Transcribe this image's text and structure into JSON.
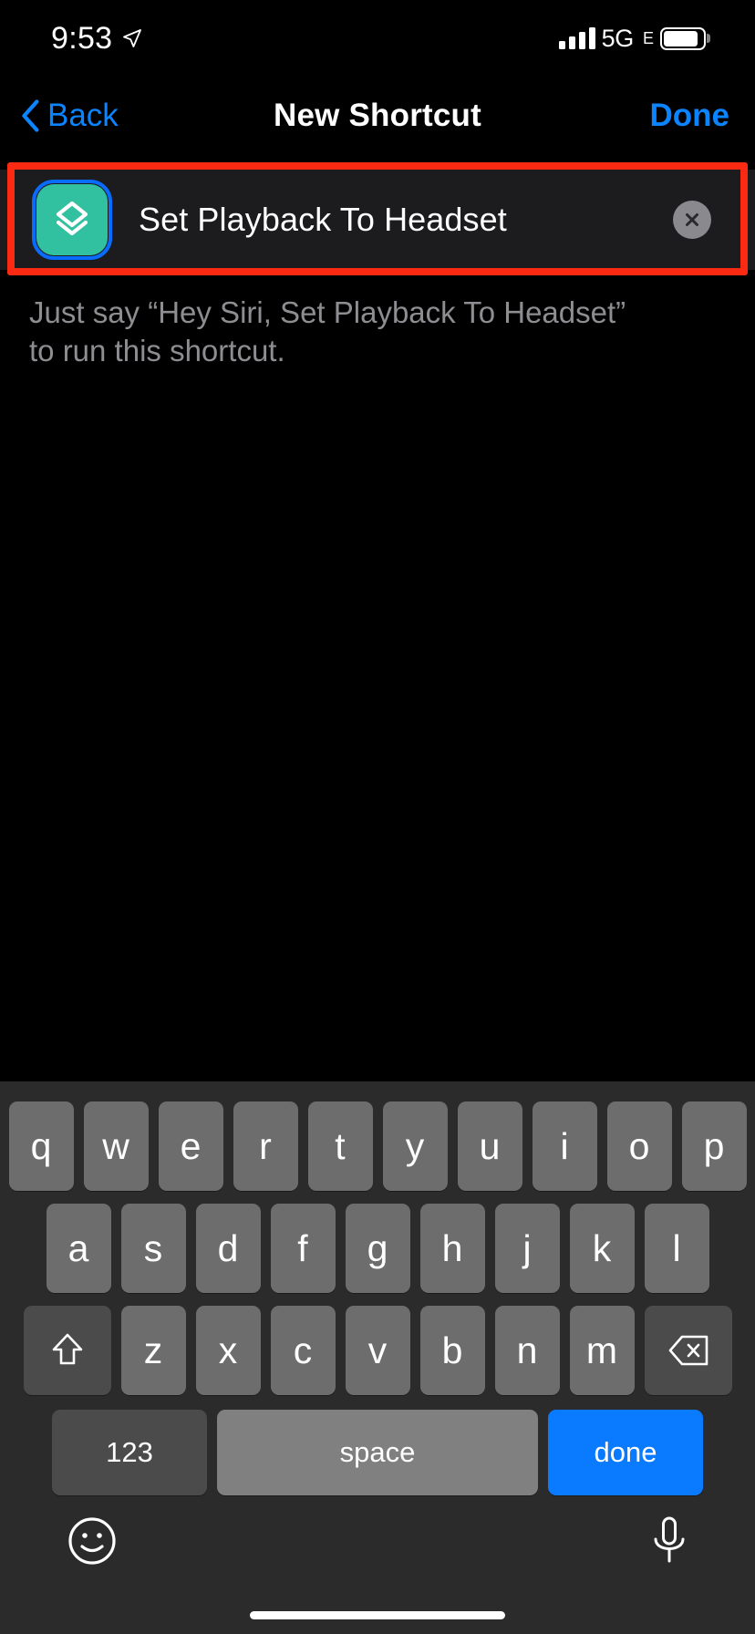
{
  "status_bar": {
    "time": "9:53",
    "location_icon": "location-arrow-icon",
    "signal_icon": "cellular-signal-icon",
    "network": "5G",
    "network_sub": "E",
    "battery_icon": "battery-icon",
    "battery_level_pct": 88
  },
  "nav_bar": {
    "back_label": "Back",
    "back_icon": "chevron-left-icon",
    "title": "New Shortcut",
    "done_label": "Done"
  },
  "name_field": {
    "shortcut_icon": "shortcut-layers-icon",
    "icon_color": "#31c0a0",
    "value": "Set Playback To Headset",
    "placeholder": "Shortcut Name",
    "clear_icon": "clear-circle-x-icon"
  },
  "annotation": {
    "highlight_color": "#fc2a12"
  },
  "hint": {
    "text": "Just say “Hey Siri, Set Playback To Headset” to run this shortcut."
  },
  "keyboard": {
    "row1": [
      "q",
      "w",
      "e",
      "r",
      "t",
      "y",
      "u",
      "i",
      "o",
      "p"
    ],
    "row2": [
      "a",
      "s",
      "d",
      "f",
      "g",
      "h",
      "j",
      "k",
      "l"
    ],
    "row3": [
      "z",
      "x",
      "c",
      "v",
      "b",
      "n",
      "m"
    ],
    "shift_icon": "shift-arrow-icon",
    "backspace_icon": "backspace-delete-icon",
    "numbers_label": "123",
    "space_label": "space",
    "done_label": "done",
    "done_color": "#0a7aff",
    "emoji_icon": "emoji-smiley-icon",
    "dictation_icon": "microphone-icon"
  },
  "home_indicator": "home-indicator-bar"
}
